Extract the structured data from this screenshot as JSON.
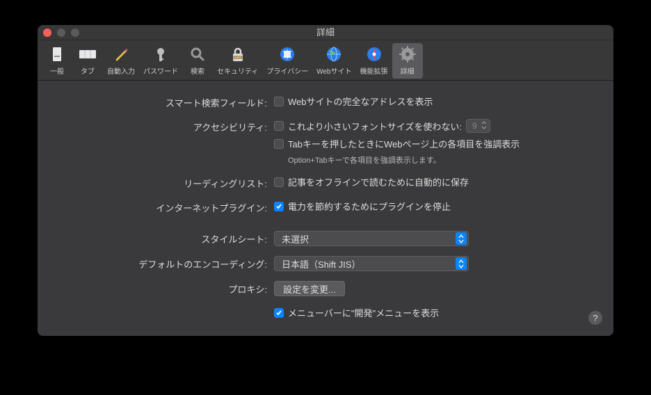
{
  "window": {
    "title": "詳細"
  },
  "toolbar": {
    "items": [
      {
        "label": "一般"
      },
      {
        "label": "タブ"
      },
      {
        "label": "自動入力"
      },
      {
        "label": "パスワード"
      },
      {
        "label": "検索"
      },
      {
        "label": "セキュリティ"
      },
      {
        "label": "プライバシー"
      },
      {
        "label": "Webサイト"
      },
      {
        "label": "機能拡張"
      },
      {
        "label": "詳細"
      }
    ],
    "selected_index": 9
  },
  "labels": {
    "smart_search": "スマート検索フィールド:",
    "accessibility": "アクセシビリティ:",
    "reading_list": "リーディングリスト:",
    "internet_plugin": "インターネットプラグイン:",
    "stylesheet": "スタイルシート:",
    "default_encoding": "デフォルトのエンコーディング:",
    "proxy": "プロキシ:"
  },
  "fields": {
    "show_full_address": "Webサイトの完全なアドレスを表示",
    "min_font": "これより小さいフォントサイズを使わない:",
    "min_font_value": "9",
    "tab_highlight": "Tabキーを押したときにWebページ上の各項目を強調表示",
    "tab_hint": "Option+Tabキーで各項目を強調表示します。",
    "offline_save": "記事をオフラインで読むために自動的に保存",
    "plugin_pause": "電力を節約するためにプラグインを停止",
    "stylesheet_value": "未選択",
    "encoding_value": "日本語（Shift JIS）",
    "proxy_button": "設定を変更...",
    "show_develop": "メニューバーに\"開発\"メニューを表示"
  },
  "checked": {
    "show_full_address": false,
    "min_font": false,
    "tab_highlight": false,
    "offline_save": false,
    "plugin_pause": true,
    "show_develop": true
  }
}
